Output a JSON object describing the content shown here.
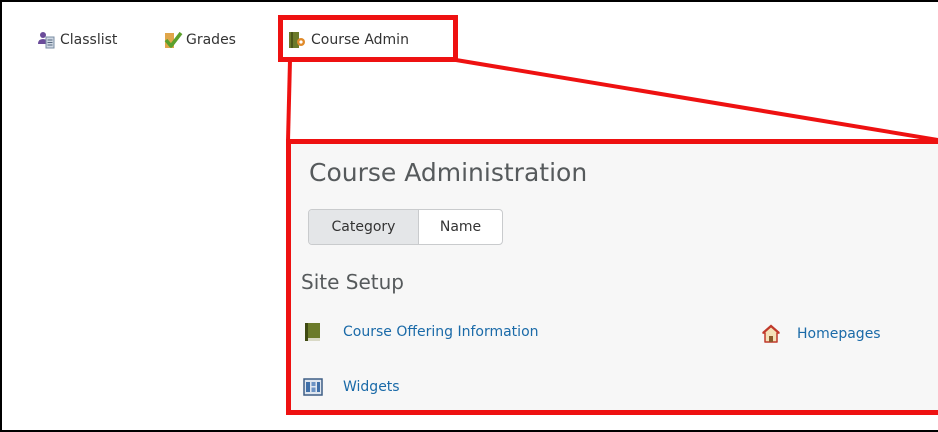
{
  "nav": {
    "items": [
      {
        "label": "Classlist",
        "icon": "classlist-icon"
      },
      {
        "label": "Grades",
        "icon": "grades-checkmark-icon"
      },
      {
        "label": "Course Admin",
        "icon": "course-admin-book-icon"
      }
    ]
  },
  "panel": {
    "title": "Course Administration",
    "view_toggle": {
      "options": [
        "Category",
        "Name"
      ],
      "selected": "Category"
    },
    "section": {
      "heading": "Site Setup",
      "tools": [
        {
          "label": "Course Offering Information",
          "icon": "green-book-icon"
        },
        {
          "label": "Homepages",
          "icon": "house-icon"
        },
        {
          "label": "Widgets",
          "icon": "widgets-grid-icon"
        }
      ]
    }
  },
  "colors": {
    "highlight": "#ee1111",
    "link": "#1a6aa8",
    "heading": "#565a5c",
    "panel_bg": "#f7f7f7"
  }
}
